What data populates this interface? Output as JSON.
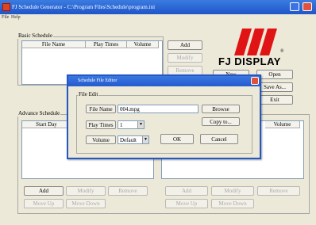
{
  "window": {
    "title": "FJ Schedule Generator - C:\\Program Files\\Schedule\\program.ini",
    "menu": [
      "File",
      "Help"
    ]
  },
  "basic": {
    "group_label": "Basic Schedule",
    "columns": [
      "File Name",
      "Play Times",
      "Volume"
    ],
    "buttons": {
      "add": "Add",
      "modify": "Modify",
      "remove": "Remove"
    }
  },
  "logo": {
    "brand": "FJ DISPLAY",
    "mark": "®"
  },
  "side_buttons": {
    "new": "New",
    "open": "Open",
    "save_as": "Save As...",
    "exit": "Exit"
  },
  "advance": {
    "group_label": "Advance Schedule",
    "columns": [
      "Start Day",
      "Volume"
    ],
    "left_buttons": {
      "add": "Add",
      "modify": "Modify",
      "remove": "Remove",
      "move_up": "Move Up",
      "move_down": "Move Down"
    },
    "right_buttons": {
      "add": "Add",
      "modify": "Modify",
      "remove": "Remove",
      "move_up": "Move Up",
      "move_down": "Move Down"
    }
  },
  "dialog": {
    "title": "Schedule File Editor",
    "group_label": "File Edit",
    "file_name_label": "File Name",
    "file_name_value": "004.mpg",
    "browse": "Browse",
    "copy_to": "Copy to...",
    "play_times_label": "Play Times",
    "play_times_value": "1",
    "volume_label": "Volume",
    "volume_value": "Default",
    "ok": "OK",
    "cancel": "Cancel"
  },
  "colors": {
    "title_bar": "#245bcf",
    "logo_red": "#e01414",
    "window_bg": "#ece9d8"
  }
}
